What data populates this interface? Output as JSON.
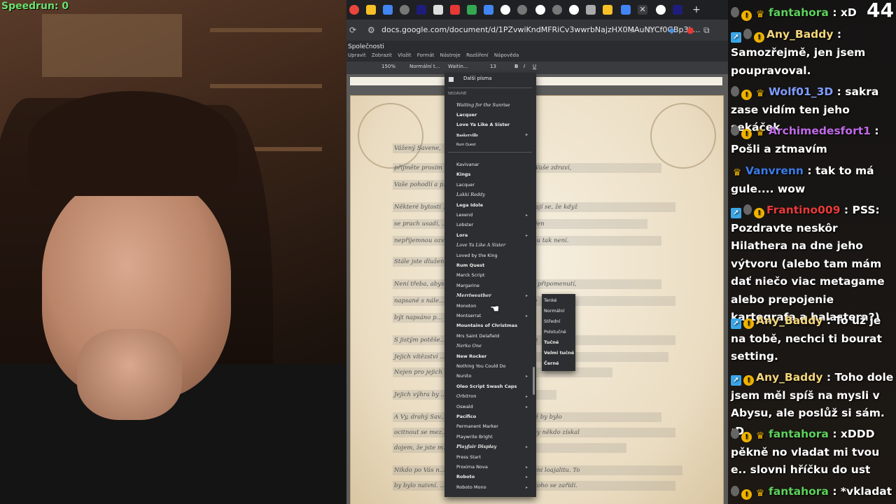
{
  "stream": {
    "speedrun_label": "Speedrun: 0"
  },
  "browser": {
    "url": "docs.google.com/document/d/1PZvwiKndMFRiCv3wwrbNajzHX0MAuNYCf0GBp3k...",
    "doc_title": "Společnosti",
    "menu": [
      "Upravit",
      "Zobrazit",
      "Vložit",
      "Formát",
      "Nástroje",
      "Rozšíření",
      "Nápověda"
    ],
    "zoom": "150%",
    "style": "Normální t...",
    "font": "Waitin...",
    "font_size": "13"
  },
  "document": {
    "lines": [
      "Vážený Savene,",
      "přijměte prosím ... našeho upřímného zájmu o Vaše zdraví,",
      "Vaše pohodlí a p...",
      "Některé bytosti ... vat čas za spojence. Domnívají se, že když",
      "se prach usadí, ... zí a staré závazky se stanou jen",
      "nepříjemnou ozvě... to konkrétním případě tomu tak není.",
      "Stále jste dlužen...",
      "Není třeba, abyst... berte to spíše jako zdvořilé připomenutí,",
      "napsané s nále... oložení, než v jakém by mohlo",
      "být napsáno p...",
      "S jistým potěše... řečnou části své malé soutěže",
      "Jejich vítězství ... Nejen pro ně, samozřejmě",
      "Nejen pro jejich ... ch hrdinů.",
      "Jejich výhra by ... dole",
      "A Vy, drahý Sav... abyste chápal, jak nepříjemné by bylo",
      "ocitnout se mez... ním dluhem. Zvláště pokud by někdo získal",
      "dojem, že jste m... Nebo hůř – že jste překážel.",
      "Nikdo po Vás n... kusně. Nikdo po Vás nežádá ani loajalitu. To",
      "by bylo naivní. ... zně, komu co náleží, a podle toho se zařídí."
    ]
  },
  "font_menu": {
    "more_fonts": "Další písma",
    "section_recent": "Nedávné",
    "recent": [
      "Waiting for the Sunrise",
      "Lacquer",
      "Love Ya Like A Sister",
      "Baskerville",
      "Rum Quest"
    ],
    "fonts": [
      "Kavivanar",
      "Kings",
      "Lacquer",
      "Lakki Reddy",
      "Lega Idole",
      "Lexend",
      "Lobster",
      "Lora",
      "Love Ya Like A Sister",
      "Loved by the King",
      "Rum Quest",
      "Marck Script",
      "Margarine",
      "Merriweather",
      "Monoton",
      "Montserrat",
      "Mountains of Christmas",
      "Mrs Saint Delafield",
      "Nerko One",
      "New Rocker",
      "Nothing You Could Do",
      "Nunito",
      "Oleo Script Swash Caps",
      "Orbitron",
      "Oswald",
      "Pacifico",
      "Permanent Marker",
      "Playwrite Bright",
      "Playfair Display",
      "Press Start",
      "Proxima Nova",
      "Roboto",
      "Roboto Mono"
    ],
    "weights": [
      "Tenké",
      "Normální",
      "Střední",
      "Polotučné",
      "Tučné",
      "Velmi tučné",
      "Černé"
    ]
  },
  "chat": {
    "counter": "44",
    "messages": [
      {
        "user": "fantahora",
        "color": "#5cd15c",
        "text": ": xD"
      },
      {
        "user": "Any_Baddy",
        "color": "#f3d67b",
        "text": ":"
      },
      {
        "user": "",
        "color": "#fff",
        "text": "Samozřejmě, jen jsem poupravoval."
      },
      {
        "user": "Wolf01_3D",
        "color": "#7f9cff",
        "text": ": sakra zase vidím ten jeho sekáček"
      },
      {
        "user": "Archimedesfort1",
        "color": "#c06ae8",
        "text": ":"
      },
      {
        "user": "",
        "color": "#fff",
        "text": "Pošli a ztmavím"
      },
      {
        "user": "Vanvrenn",
        "color": "#3a7be8",
        "text": ": tak to má gule.... wow"
      },
      {
        "user": "Frantino009",
        "color": "#e83a3a",
        "text": ": PSS: Pozdravte neskôr Hilathera na dne jeho výtvoru (alebo tam mám dať niečo viac metagame alebo prepojenie kartografa a halastera?)"
      },
      {
        "user": "Any_Baddy",
        "color": "#f3d67b",
        "text": ": To už je na tobě, nechci ti bourat setting."
      },
      {
        "user": "Any_Baddy",
        "color": "#f3d67b",
        "text": ": Toho dole jsem měl spíš na mysli v Abysu, ale poslůž si sám. :D"
      },
      {
        "user": "fantahora",
        "color": "#5cd15c",
        "text": ": xDDD pěkně no vladat mi tvou e.. slovni hříčku do ust"
      },
      {
        "user": "fantahora",
        "color": "#5cd15c",
        "text": ": *vkladat"
      }
    ]
  }
}
